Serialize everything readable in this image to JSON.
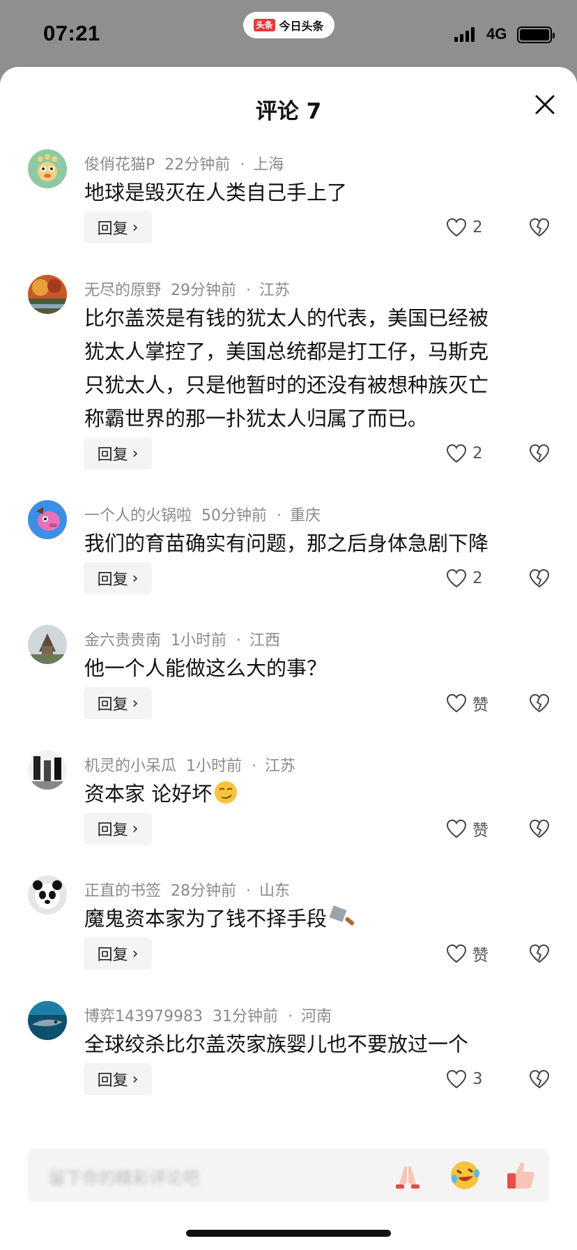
{
  "status_bar": {
    "time": "07:21",
    "app_badge": "头条",
    "app_name": "今日头条",
    "network": "4G",
    "battery_level": 1.0
  },
  "sheet": {
    "title": "评论 7",
    "close_icon": "close-icon"
  },
  "comments": [
    {
      "user": "俊俏花猫P",
      "time": "22分钟前",
      "location": "上海",
      "text": "地球是毁灭在人类自己手上了",
      "reply_label": "回复",
      "likes": "2"
    },
    {
      "user": "无尽的原野",
      "time": "29分钟前",
      "location": "江苏",
      "text": "比尔盖茨是有钱的犹太人的代表，美国已经被\n犹太人掌控了，美国总统都是打工仔，马斯克\n只犹太人，只是他暂时的还没有被想种族灭亡\n称霸世界的那一扑犹太人归属了而已。",
      "reply_label": "回复",
      "likes": "2"
    },
    {
      "user": "一个人的火锅啦",
      "time": "50分钟前",
      "location": "重庆",
      "text": "我们的育苗确实有问题，那之后身体急剧下降",
      "reply_label": "回复",
      "likes": "2"
    },
    {
      "user": "金六贵贵南",
      "time": "1小时前",
      "location": "江西",
      "text": "他一个人能做这么大的事？",
      "reply_label": "回复",
      "likes": "赞"
    },
    {
      "user": "机灵的小呆瓜",
      "time": "1小时前",
      "location": "江苏",
      "text": "资本家 论好坏",
      "reply_label": "回复",
      "likes": "赞"
    },
    {
      "user": "正直的书签",
      "time": "28分钟前",
      "location": "山东",
      "text": "魔鬼资本家为了钱不择手段",
      "reply_label": "回复",
      "likes": "赞"
    },
    {
      "user": "博弈143979983",
      "time": "31分钟前",
      "location": "河南",
      "text": "全球绞杀比尔盖茨家族婴儿也不要放过一个",
      "reply_label": "回复",
      "likes": "3"
    }
  ],
  "input_bar": {
    "placeholder": "留下你的精彩评论吧",
    "emojis": [
      "clap-emoji",
      "laughing-emoji",
      "thumbs-up-emoji"
    ]
  },
  "colors": {
    "background_dim": "#8f8f8f",
    "sheet": "#ffffff",
    "meta_text": "#8a8a8a",
    "brand_red": "#e8383d"
  }
}
